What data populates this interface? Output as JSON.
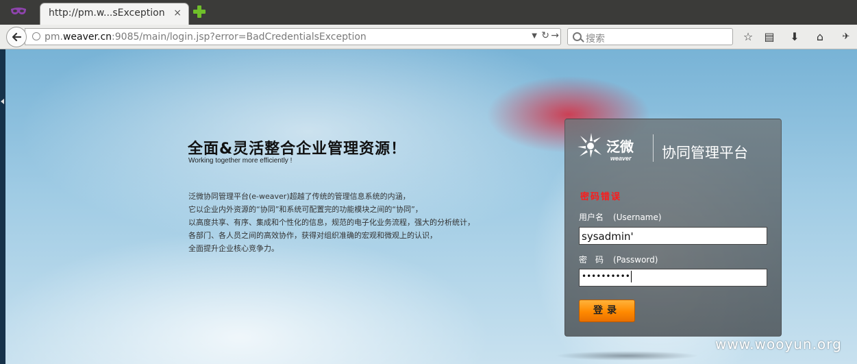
{
  "browser": {
    "tab_title": "http://pm.w...sException",
    "tab_close": "×",
    "url_prefix": "pm.",
    "url_host": "weaver.cn",
    "url_rest": ":9085/main/login.jsp?error=BadCredentialsException",
    "search_placeholder": "搜索"
  },
  "page": {
    "headline": "全面&灵活整合企业管理资源！",
    "subline": "Working together more efficiently !",
    "description": [
      "泛微协同管理平台(e-weaver)超越了传统的管理信息系统的内涵，",
      "它以企业内外资源的“协同”和系统可配置完的功能模块之间的“协同”，",
      "以高度共享、有序、集成和个性化的信息，规范的电子化业务流程，强大的分析统计，",
      "各部门、各人员之间的高效协作，获得对组织准确的宏观和微观上的认识，",
      "全面提升企业核心竞争力。"
    ]
  },
  "login": {
    "logo_text": "泛微",
    "logo_sub": "weaver",
    "platform_title": "协同管理平台",
    "error_message": "密码错误",
    "username_label_cn": "用户名",
    "username_label_en": "(Username)",
    "username_value": "sysadmin'",
    "password_label_cn": "密　码",
    "password_label_en": "(Password)",
    "password_value": "••••••••••",
    "submit_label": "登录"
  },
  "watermark": "www.wooyun.org"
}
